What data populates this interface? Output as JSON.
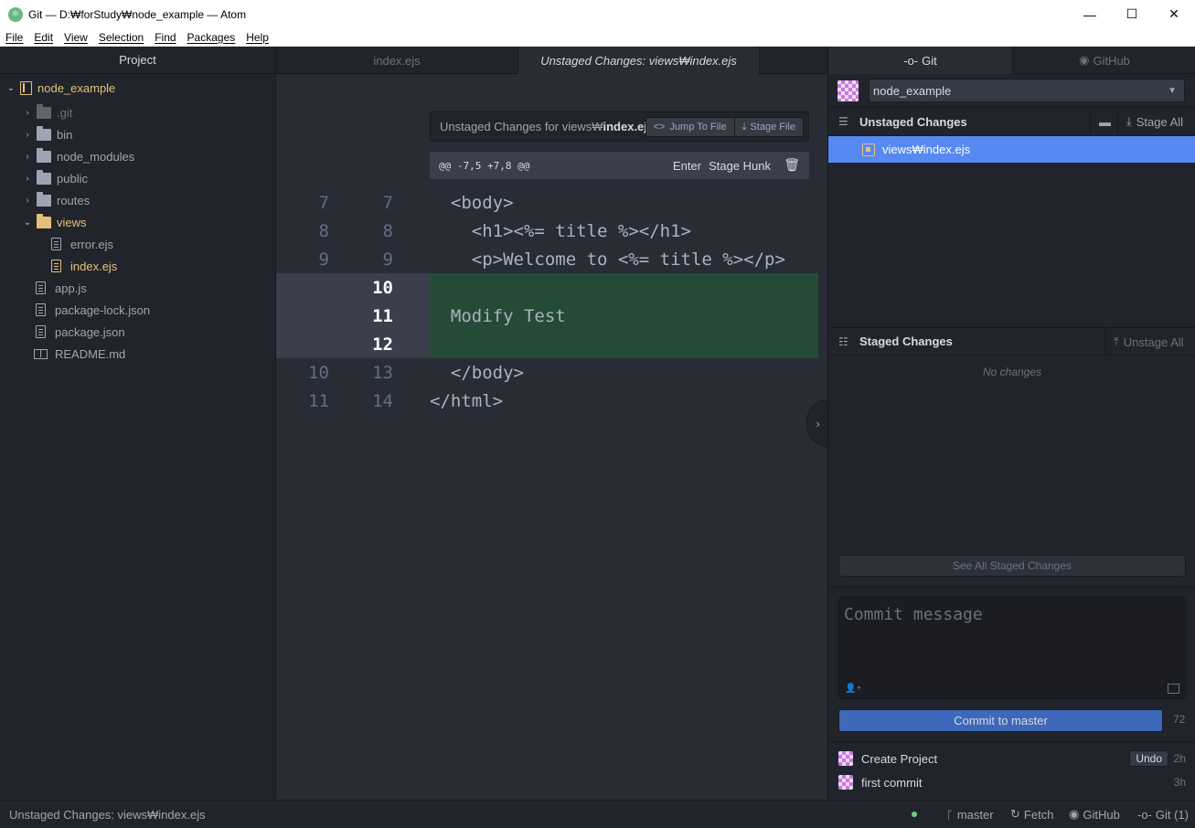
{
  "window": {
    "title": "Git — D:₩forStudy₩node_example — Atom",
    "minimize": "—",
    "maximize": "☐",
    "close": "✕"
  },
  "menu": [
    "File",
    "Edit",
    "View",
    "Selection",
    "Find",
    "Packages",
    "Help"
  ],
  "tree": {
    "header": "Project",
    "root": "node_example",
    "items": [
      ".git",
      "bin",
      "node_modules",
      "public",
      "routes",
      "views",
      "error.ejs",
      "index.ejs",
      "app.js",
      "package-lock.json",
      "package.json",
      "README.md"
    ]
  },
  "editor": {
    "tabs": [
      "index.ejs",
      "Unstaged Changes: views₩index.ejs"
    ],
    "diff_title_prefix": "Unstaged Changes for views₩",
    "diff_title_file": "index.ejs",
    "jump_to_file": "Jump To File",
    "stage_file": "Stage File",
    "hunk_range": "@@ -7,5 +7,8 @@",
    "hunk_enter": "Enter",
    "hunk_stage": "Stage Hunk",
    "lines": [
      {
        "old": "7",
        "new": "7",
        "code": "  <body>",
        "added": false
      },
      {
        "old": "8",
        "new": "8",
        "code": "    <h1><%= title %></h1>",
        "added": false
      },
      {
        "old": "9",
        "new": "9",
        "code": "    <p>Welcome to <%= title %></p>",
        "added": false
      },
      {
        "old": "",
        "new": "10",
        "code": "",
        "added": true
      },
      {
        "old": "",
        "new": "11",
        "code": "  Modify Test",
        "added": true
      },
      {
        "old": "",
        "new": "12",
        "code": "",
        "added": true
      },
      {
        "old": "10",
        "new": "13",
        "code": "  </body>",
        "added": false
      },
      {
        "old": "11",
        "new": "14",
        "code": "</html>",
        "added": false
      }
    ]
  },
  "git": {
    "tab_git": "Git",
    "tab_github": "GitHub",
    "repo": "node_example",
    "unstaged_title": "Unstaged Changes",
    "stage_all": "Stage All",
    "unstaged_file": "views₩index.ejs",
    "staged_title": "Staged Changes",
    "unstage_all": "Unstage All",
    "no_changes": "No changes",
    "see_all": "See All Staged Changes",
    "commit_placeholder": "Commit message",
    "commit_button": "Commit to master",
    "commit_remaining": "72",
    "recent": [
      {
        "message": "Create Project",
        "time": "2h",
        "undo": "Undo"
      },
      {
        "message": "first commit",
        "time": "3h"
      }
    ]
  },
  "status": {
    "left": "Unstaged Changes: views₩index.ejs",
    "branch": "master",
    "fetch": "Fetch",
    "github": "GitHub",
    "git": "Git (1)"
  },
  "colors": {
    "added_bg": "#244b36",
    "selection": "#568af2",
    "commit_button": "#3e68b9",
    "folder_open": "#e5c07b"
  }
}
